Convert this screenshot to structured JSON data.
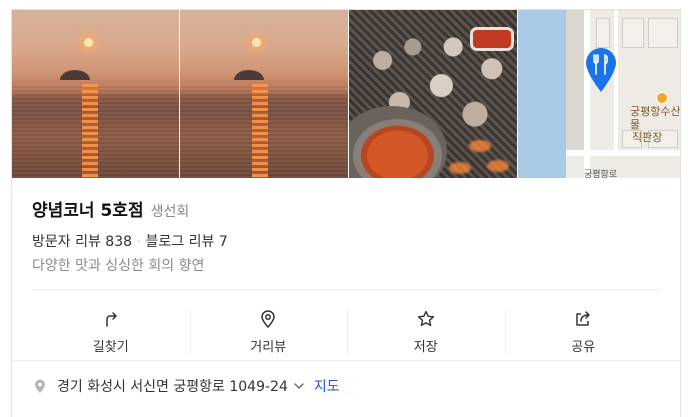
{
  "place": {
    "name": "양념코너 5호점",
    "category": "생선회",
    "visitor_reviews": "방문자 리뷰 838",
    "blog_reviews": "블로그 리뷰 7",
    "separator": "·",
    "description": "다양한 맛과 싱싱한 회의 향연"
  },
  "photos": [
    {
      "kind": "sunset-sea"
    },
    {
      "kind": "sunset-sea"
    },
    {
      "kind": "grilled-shellfish"
    },
    {
      "kind": "map"
    }
  ],
  "map": {
    "poi_label_line1": "궁평항수산물",
    "poi_label_line2": "직판장",
    "road_label": "궁평항로",
    "pin_color": "#1a73e8"
  },
  "actions": [
    {
      "label": "길찾기",
      "icon": "directions-icon"
    },
    {
      "label": "거리뷰",
      "icon": "street-view-icon"
    },
    {
      "label": "저장",
      "icon": "star-icon"
    },
    {
      "label": "공유",
      "icon": "share-icon"
    }
  ],
  "address": {
    "text": "경기 화성시 서신면 궁평항로 1049-24",
    "map_link": "지도"
  },
  "colors": {
    "link": "#1a56d6",
    "muted": "#888888",
    "pin": "#1a73e8"
  }
}
